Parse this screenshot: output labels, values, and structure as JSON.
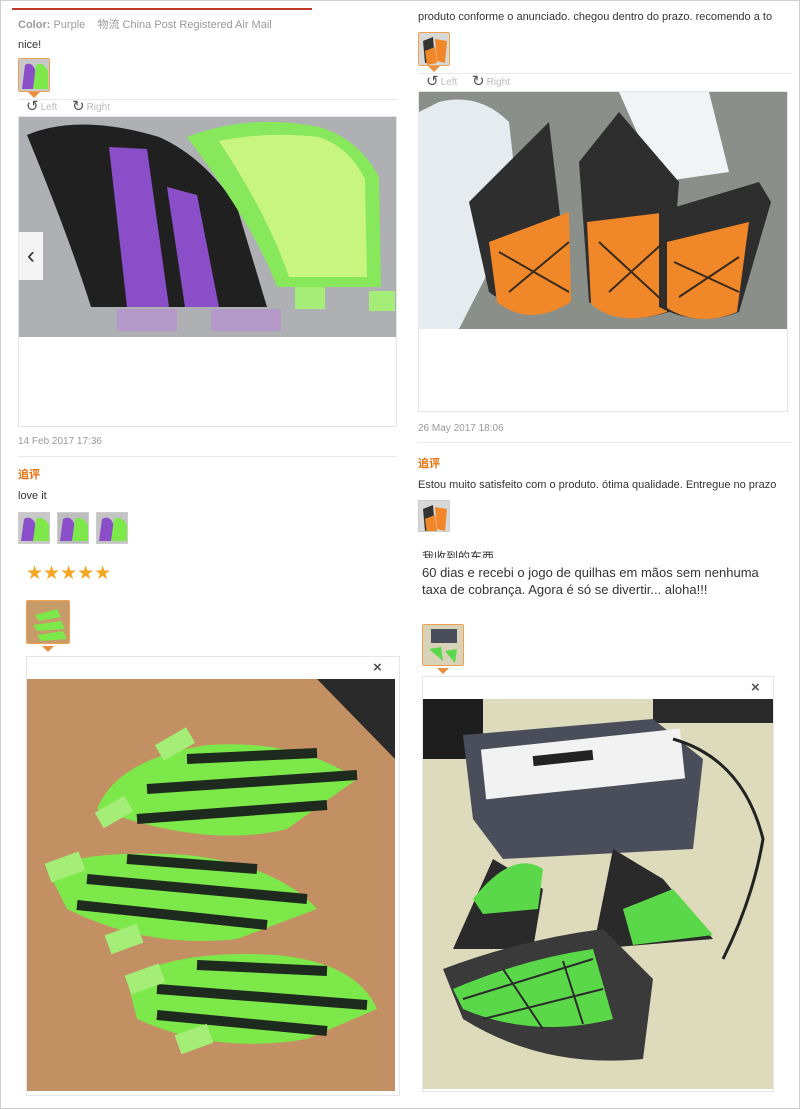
{
  "left_top": {
    "color_label": "Color:",
    "color_value": "Purple",
    "shipping": "物流 China Post Registered Air Mail",
    "comment": "nice!",
    "rotate_left": "Left",
    "rotate_right": "Right",
    "date": "14 Feb 2017 17:36",
    "followup_label": "追评",
    "followup_text": "love it"
  },
  "right_top": {
    "comment": "produto conforme o anunciado. chegou dentro do prazo. recomendo a to",
    "rotate_left": "Left",
    "rotate_right": "Right",
    "date": "26 May 2017 18:06",
    "followup_label": "追评",
    "followup_text": "Estou muito satisfeito com o produto. ótima qualidade. Entregue no prazo"
  },
  "left_bottom": {
    "stars": "★★★★★",
    "close": "×"
  },
  "right_bottom": {
    "partial_heading": "我收到的东西",
    "comment": "60 dias e recebi o jogo de quilhas em mãos sem nenhuma taxa de cobrança. Agora é só se divertir... aloha!!!",
    "close": "×"
  },
  "icons": {
    "rotate_left_glyph": "↺",
    "rotate_right_glyph": "↻",
    "prev_glyph": "‹"
  },
  "colors": {
    "accent": "#e8720c",
    "star": "#f5a623",
    "purple_fin": "#8a4fc8",
    "green_fin": "#7de84a",
    "orange_fin": "#f0882a"
  }
}
